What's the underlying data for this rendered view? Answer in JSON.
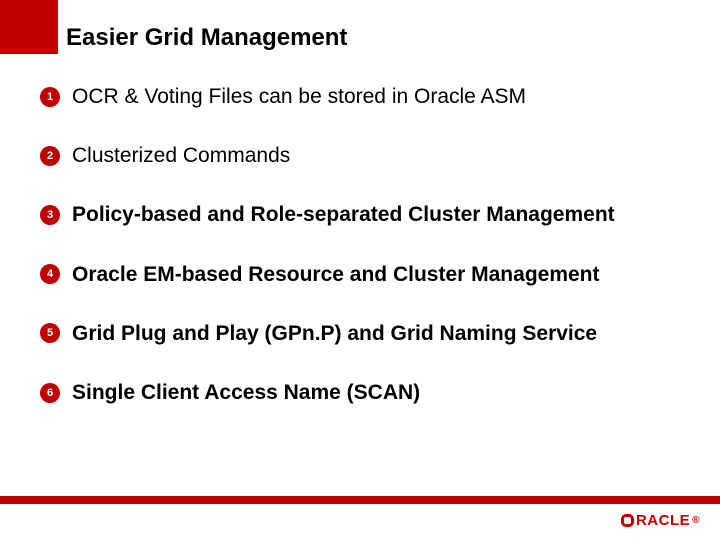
{
  "title": "Easier Grid Management",
  "items": [
    {
      "num": "1",
      "text": "OCR & Voting Files can be stored in Oracle ASM",
      "bold": false
    },
    {
      "num": "2",
      "text": "Clusterized Commands",
      "bold": false
    },
    {
      "num": "3",
      "text": "Policy-based and Role-separated Cluster Management",
      "bold": true
    },
    {
      "num": "4",
      "text": "Oracle EM-based Resource and Cluster Management",
      "bold": true
    },
    {
      "num": "5",
      "text": "Grid Plug and Play (GPn.P) and Grid Naming Service",
      "bold": true
    },
    {
      "num": "6",
      "text": "Single Client Access Name (SCAN)",
      "bold": true
    }
  ],
  "logo": {
    "text": "RACLE"
  },
  "colors": {
    "accent": "#c00000"
  }
}
